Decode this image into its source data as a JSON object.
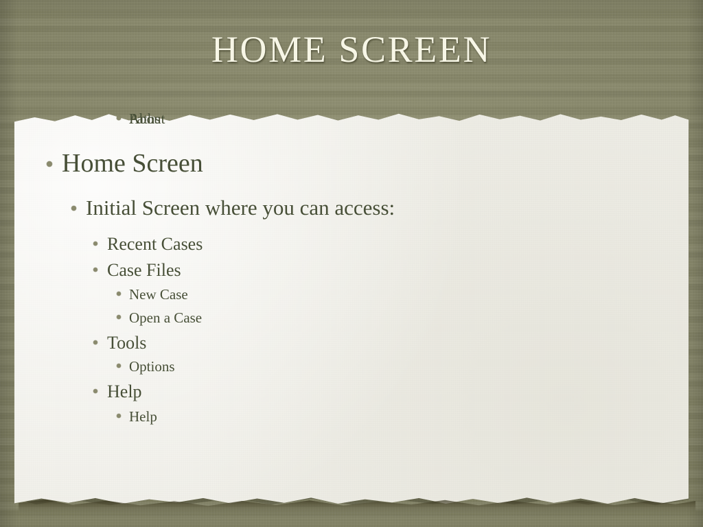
{
  "slide": {
    "title": "HOME SCREEN",
    "background_color": "#8a8a68",
    "paper_color": "#efeee7",
    "title_color": "#f7f6e6",
    "text_color": "#474f37",
    "bullet_color": "#8a8a6d"
  },
  "outline": {
    "level1": {
      "label": "Home Screen"
    },
    "level2": {
      "label": "Initial Screen where you can access:"
    },
    "items": [
      {
        "level": 3,
        "label": "Recent Cases"
      },
      {
        "level": 3,
        "label": "Case Files"
      },
      {
        "level": 4,
        "label": "New Case"
      },
      {
        "level": 4,
        "label": "Open a Case"
      },
      {
        "level": 3,
        "label": "Tools"
      },
      {
        "level": 4,
        "label": "Options"
      },
      {
        "level": 3,
        "label": "Help"
      },
      {
        "level": 4,
        "label": "Help"
      },
      {
        "level": 4,
        "label": "Paths"
      },
      {
        "level": 4,
        "label": "About"
      }
    ]
  }
}
